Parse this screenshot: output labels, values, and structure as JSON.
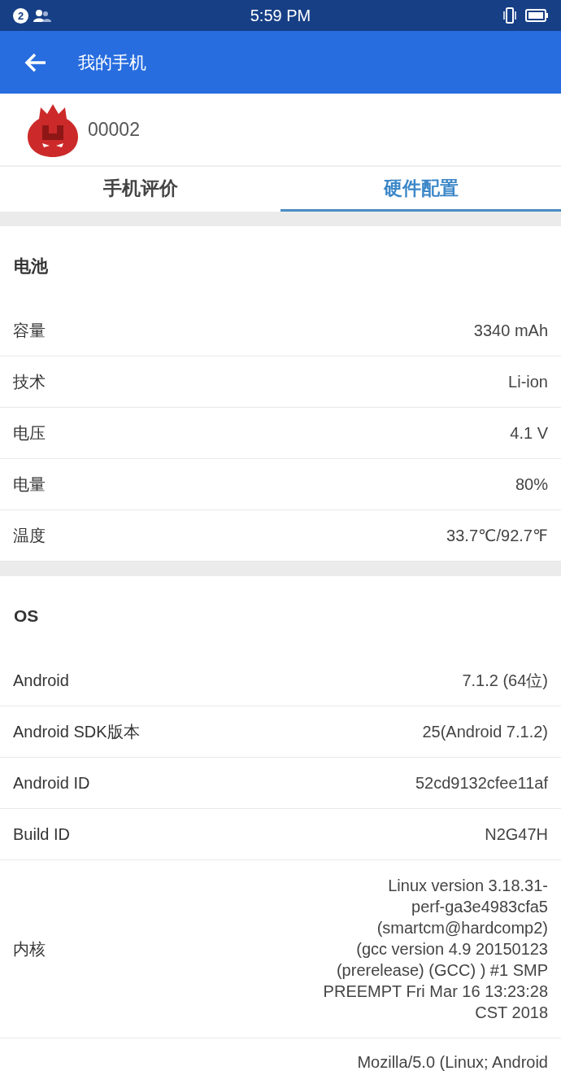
{
  "status_bar": {
    "notification_count": "2",
    "time": "5:59 PM"
  },
  "app_bar": {
    "title": "我的手机"
  },
  "device": {
    "name": "00002"
  },
  "tabs": [
    {
      "label": "手机评价",
      "selected": false
    },
    {
      "label": "硬件配置",
      "selected": true
    }
  ],
  "sections": [
    {
      "title": "电池",
      "rows": [
        {
          "label": "容量",
          "value": "3340 mAh"
        },
        {
          "label": "技术",
          "value": "Li-ion"
        },
        {
          "label": "电压",
          "value": "4.1 V"
        },
        {
          "label": "电量",
          "value": "80%"
        },
        {
          "label": "温度",
          "value": "33.7℃/92.7℉"
        }
      ]
    },
    {
      "title": "OS",
      "rows": [
        {
          "label": "Android",
          "value": "7.1.2 (64位)"
        },
        {
          "label": "Android SDK版本",
          "value": "25(Android 7.1.2)"
        },
        {
          "label": "Android ID",
          "value": "52cd9132cfee11af"
        },
        {
          "label": "Build ID",
          "value": "N2G47H"
        },
        {
          "label": "内核",
          "value": "Linux version 3.18.31-\nperf-ga3e4983cfa5\n(smartcm@hardcomp2)\n(gcc version 4.9 20150123\n(prerelease) (GCC) ) #1 SMP\nPREEMPT Fri Mar 16 13:23:28\nCST 2018"
        },
        {
          "value": "Mozilla/5.0 (Linux; Android"
        }
      ]
    }
  ]
}
